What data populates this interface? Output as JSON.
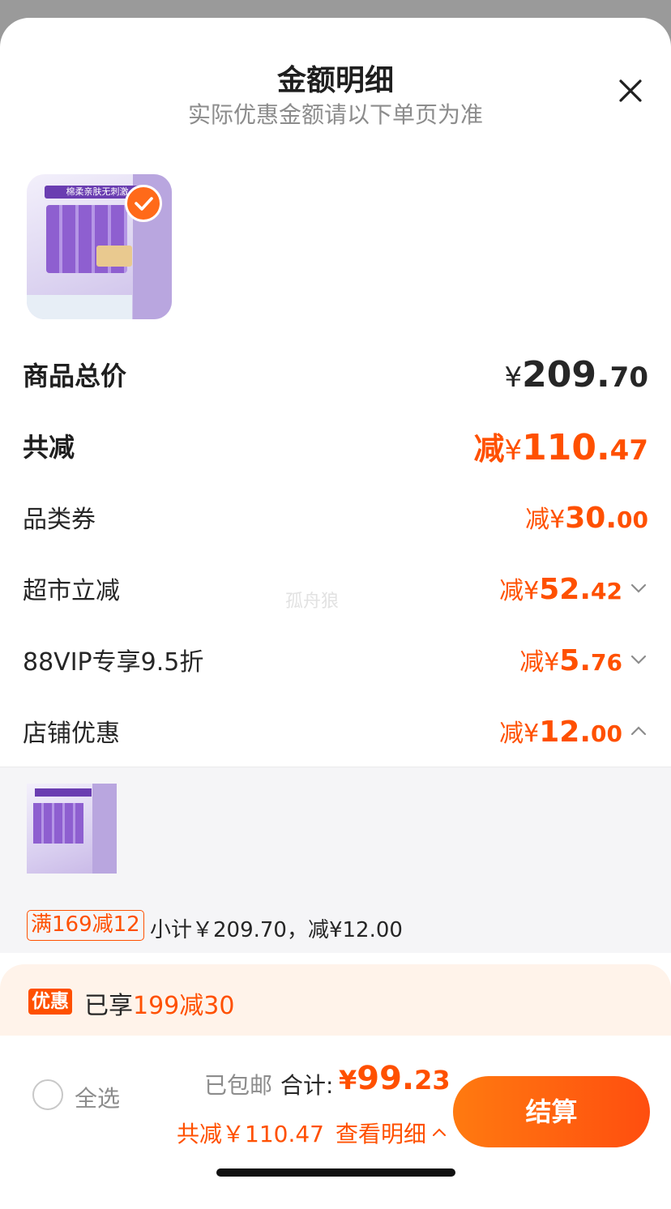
{
  "header": {
    "title": "金额明细",
    "subtitle": "实际优惠金额请以下单页为准"
  },
  "product": {
    "thumb_banner": "棉柔亲肤无刺激",
    "selected": true
  },
  "summary": {
    "total_label": "商品总价",
    "total_sym": "¥",
    "total_int": "209.",
    "total_dec": "70",
    "reduce_label": "共减",
    "reduce_pre": "减",
    "reduce_sym": "¥",
    "reduce_int": "110.",
    "reduce_dec": "47"
  },
  "discounts": [
    {
      "label": "品类券",
      "pre": "减",
      "sym": "¥",
      "int": "30.",
      "dec": "00",
      "chevron": "none"
    },
    {
      "label": "超市立减",
      "pre": "减",
      "sym": "¥",
      "int": "52.",
      "dec": "42",
      "chevron": "chevron-down"
    },
    {
      "label": "88VIP专享9.5折",
      "pre": "减",
      "sym": "¥",
      "int": "5.",
      "dec": "76",
      "chevron": "chevron-down"
    },
    {
      "label": "店铺优惠",
      "pre": "减",
      "sym": "¥",
      "int": "12.",
      "dec": "00",
      "chevron": "chevron-up"
    }
  ],
  "store_detail": {
    "tag": "满169减12",
    "subtotal": "小计￥209.70，减¥12.00"
  },
  "promo": {
    "badge": "优惠",
    "prefix": "已享",
    "highlight": "199减30"
  },
  "footer": {
    "select_all": "全选",
    "shipping": "已包邮",
    "total_label": "合计:",
    "total_sym": "¥",
    "total_int": "99.",
    "total_dec": "23",
    "reduce_text": "共减￥110.47",
    "view_detail": "查看明细",
    "checkout": "结算"
  },
  "watermark": "孤舟狼",
  "colors": {
    "accent": "#ff5000",
    "overlay": "#9a9a9a",
    "promo_bg": "#fff3ea"
  }
}
